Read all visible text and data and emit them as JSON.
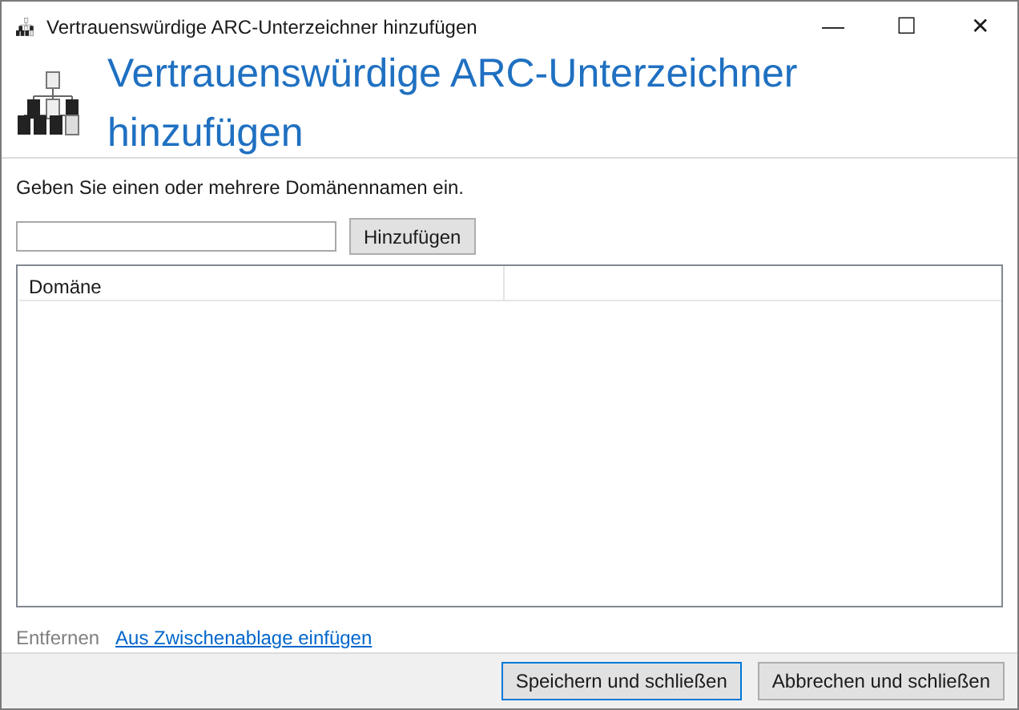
{
  "window": {
    "title": "Vertrauenswürdige ARC-Unterzeichner hinzufügen",
    "controls": [
      "—",
      "☐",
      "✕"
    ]
  },
  "header": {
    "title": "Vertrauenswürdige ARC-Unterzeichner hinzufügen"
  },
  "instruction": "Geben Sie einen oder mehrere Domänennamen ein.",
  "add_button": "Hinzufügen",
  "table": {
    "columns": [
      "Domäne"
    ]
  },
  "actions": [
    {
      "label": "Entfernen",
      "disabled": true
    },
    {
      "label": "Aus Zwischenablage einfügen",
      "disabled": false
    }
  ],
  "buttons": [
    {
      "label": "Speichern und schließen",
      "default": true
    },
    {
      "label": "Abbrechen und schließen",
      "default": false
    }
  ]
}
